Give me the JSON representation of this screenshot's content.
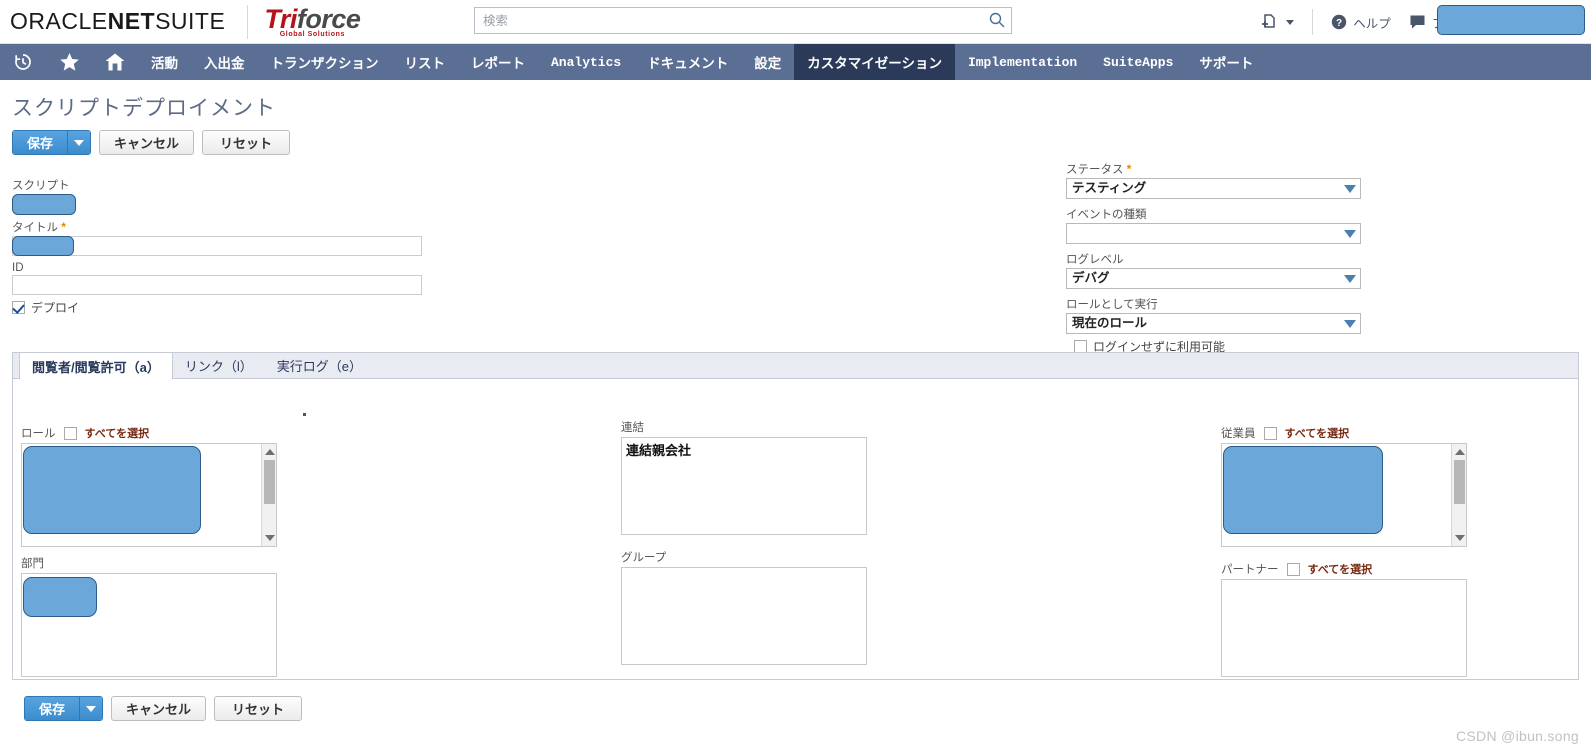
{
  "header": {
    "oracle_brand": "ORACLE",
    "netsuite_bold": "NET",
    "netsuite_light": "SUITE",
    "triforce_tri": "Tri",
    "triforce_force": "force",
    "triforce_sub": "Global Solutions",
    "search_placeholder": "検索",
    "search_value": "",
    "help_label": "ヘルプ",
    "feedback_label": "フィードバック"
  },
  "nav": {
    "items": [
      {
        "label": "活動",
        "mono": false,
        "active": false
      },
      {
        "label": "入出金",
        "mono": false,
        "active": false
      },
      {
        "label": "トランザクション",
        "mono": false,
        "active": false
      },
      {
        "label": "リスト",
        "mono": false,
        "active": false
      },
      {
        "label": "レポート",
        "mono": false,
        "active": false
      },
      {
        "label": "Analytics",
        "mono": true,
        "active": false
      },
      {
        "label": "ドキュメント",
        "mono": false,
        "active": false
      },
      {
        "label": "設定",
        "mono": false,
        "active": false
      },
      {
        "label": "カスタマイゼーション",
        "mono": false,
        "active": true
      },
      {
        "label": "Implementation",
        "mono": true,
        "active": false
      },
      {
        "label": "SuiteApps",
        "mono": true,
        "active": false
      },
      {
        "label": "サポート",
        "mono": false,
        "active": false
      }
    ]
  },
  "page": {
    "title": "スクリプトデプロイメント"
  },
  "toolbar": {
    "save_label": "保存",
    "cancel_label": "キャンセル",
    "reset_label": "リセット"
  },
  "form": {
    "left": {
      "script_label": "スクリプト",
      "script_value": "",
      "title_label": "タイトル",
      "title_value": "",
      "id_label": "ID",
      "id_value": "",
      "deploy_label": "デプロイ",
      "deploy_checked": true
    },
    "right": {
      "status_label": "ステータス",
      "status_value": "テスティング",
      "event_type_label": "イベントの種類",
      "event_type_value": "",
      "log_level_label": "ログレベル",
      "log_level_value": "デバグ",
      "execute_as_role_label": "ロールとして実行",
      "execute_as_role_value": "現在のロール",
      "available_without_login_label": "ログインせずに利用可能",
      "available_without_login_checked": false
    }
  },
  "panel": {
    "tabs": [
      {
        "label": "閲覧者/閲覧許可（a）",
        "accel": "a",
        "active": true
      },
      {
        "label": "リンク（l）",
        "accel": "l",
        "active": false
      },
      {
        "label": "実行ログ（e）",
        "accel": "e",
        "active": false
      }
    ],
    "select_all_label": "すべてを選択",
    "fields": {
      "role_label": "ロール",
      "role_items": [],
      "department_label": "部門",
      "department_items": [],
      "subsidiary_label": "連結",
      "subsidiary_items": [
        "連結親会社"
      ],
      "group_label": "グループ",
      "group_items": [],
      "employee_label": "従業員",
      "employee_items": [],
      "partner_label": "パートナー",
      "partner_items": []
    }
  },
  "watermark": {
    "text": "CSDN @ibun.song"
  },
  "colors": {
    "nav_bg": "#5b6e93",
    "nav_active_bg": "#2c3a5a",
    "primary_button": "#3c8ccd",
    "highlight_blue": "#6ba7d8",
    "required_star": "#e08a00",
    "title_text": "#5c6b86"
  }
}
